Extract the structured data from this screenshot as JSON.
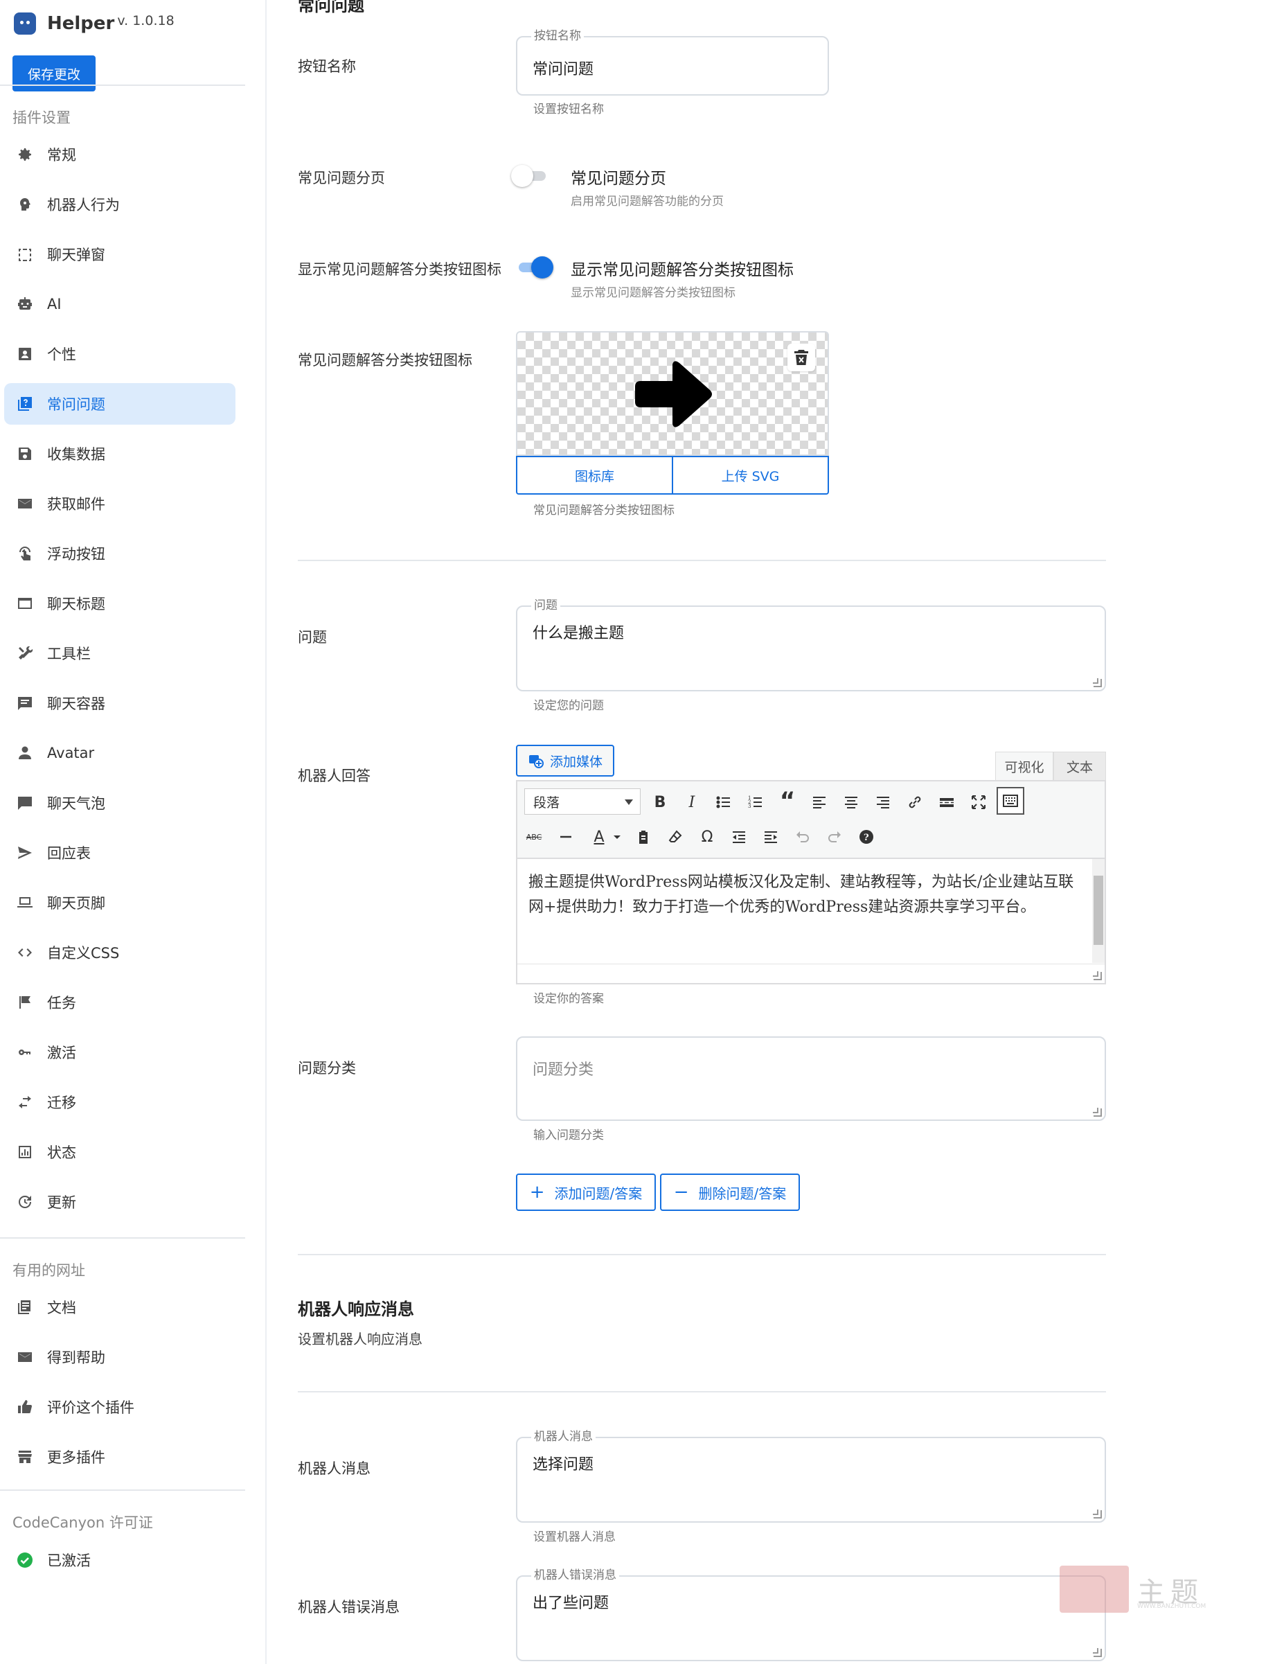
{
  "app": {
    "name": "Helper",
    "version": "v. 1.0.18",
    "save_label": "保存更改"
  },
  "sidebar": {
    "plugin_heading": "插件设置",
    "items": [
      {
        "label": "常规",
        "icon": "gear-icon"
      },
      {
        "label": "机器人行为",
        "icon": "head-icon"
      },
      {
        "label": "聊天弹窗",
        "icon": "popup-icon"
      },
      {
        "label": "AI",
        "icon": "robot-icon"
      },
      {
        "label": "个性",
        "icon": "person-card-icon"
      },
      {
        "label": "常问问题",
        "icon": "faq-icon",
        "active": true
      },
      {
        "label": "收集数据",
        "icon": "save-icon"
      },
      {
        "label": "获取邮件",
        "icon": "mail-icon"
      },
      {
        "label": "浮动按钮",
        "icon": "touch-icon"
      },
      {
        "label": "聊天标题",
        "icon": "window-icon"
      },
      {
        "label": "工具栏",
        "icon": "tools-icon"
      },
      {
        "label": "聊天容器",
        "icon": "chat-box-icon"
      },
      {
        "label": "Avatar",
        "icon": "user-icon"
      },
      {
        "label": "聊天气泡",
        "icon": "bubble-icon"
      },
      {
        "label": "回应表",
        "icon": "send-icon"
      },
      {
        "label": "聊天页脚",
        "icon": "laptop-icon"
      },
      {
        "label": "自定义CSS",
        "icon": "code-icon"
      },
      {
        "label": "任务",
        "icon": "flag-icon"
      },
      {
        "label": "激活",
        "icon": "key-icon"
      },
      {
        "label": "迁移",
        "icon": "transfer-icon"
      },
      {
        "label": "状态",
        "icon": "chart-icon"
      },
      {
        "label": "更新",
        "icon": "refresh-icon"
      }
    ],
    "links_heading": "有用的网址",
    "links": [
      {
        "label": "文档",
        "icon": "docs-icon"
      },
      {
        "label": "得到帮助",
        "icon": "mail-icon"
      },
      {
        "label": "评价这个插件",
        "icon": "thumb-up-icon"
      },
      {
        "label": "更多插件",
        "icon": "store-icon"
      }
    ],
    "license_heading": "CodeCanyon 许可证",
    "license_status": "已激活",
    "colors": {
      "active_bg": "#dcebfc",
      "accent": "#1570e0",
      "success": "#22b14c"
    }
  },
  "main": {
    "section_title": "常问问题",
    "button_name": {
      "label": "按钮名称",
      "legend": "按钮名称",
      "value": "常问问题",
      "help": "设置按钮名称"
    },
    "faq_pagination": {
      "label": "常见问题分页",
      "title": "常见问题分页",
      "desc": "启用常见问题解答功能的分页",
      "enabled": false
    },
    "show_category_icon": {
      "label": "显示常见问题解答分类按钮图标",
      "title": "显示常见问题解答分类按钮图标",
      "desc": "显示常见问题解答分类按钮图标",
      "enabled": true
    },
    "category_icon": {
      "label": "常见问题解答分类按钮图标",
      "icon": "arrow-right-icon",
      "library_label": "图标库",
      "upload_label": "上传 SVG",
      "help": "常见问题解答分类按钮图标"
    },
    "question": {
      "label": "问题",
      "legend": "问题",
      "value": "什么是搬主题",
      "help": "设定您的问题"
    },
    "bot_answer": {
      "label": "机器人回答",
      "media_label": "添加媒体",
      "tab_visual": "可视化",
      "tab_text": "文本",
      "format_select": "段落",
      "content": "搬主题提供WordPress网站模板汉化及定制、建站教程等，为站长/企业建站互联网+提供助力！致力于打造一个优秀的WordPress建站资源共享学习平台。",
      "help": "设定你的答案"
    },
    "question_category": {
      "label": "问题分类",
      "placeholder": "问题分类",
      "help": "输入问题分类"
    },
    "add_label": "添加问题/答案",
    "remove_label": "删除问题/答案",
    "bot_response": {
      "title": "机器人响应消息",
      "desc": "设置机器人响应消息"
    },
    "bot_message": {
      "label": "机器人消息",
      "legend": "机器人消息",
      "value": "选择问题",
      "help": "设置机器人消息"
    },
    "bot_error": {
      "label": "机器人错误消息",
      "legend": "机器人错误消息",
      "value": "出了些问题"
    }
  },
  "watermark": {
    "text": "主题",
    "small": "WWW.BANZHUTI.COM"
  }
}
